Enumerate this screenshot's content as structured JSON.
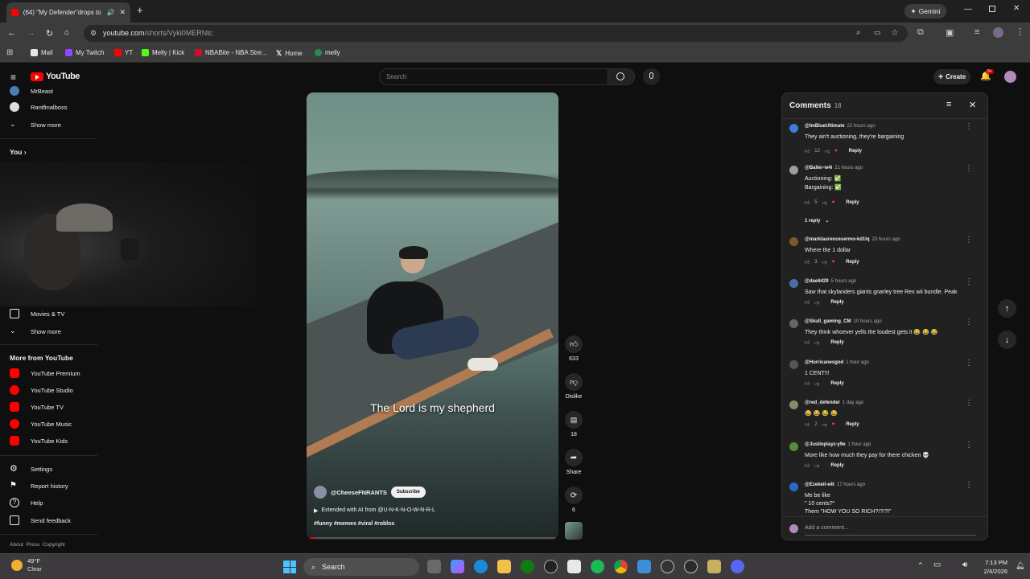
{
  "browser": {
    "tab_title": "(64) \"My Defender\"drops to",
    "url_domain": "youtube.com",
    "url_path": "/shorts/Vyki0MERNtc",
    "gemini_label": "Gemini",
    "bookmarks": [
      "Mail",
      "My Twitch",
      "YT",
      "Melly | Kick",
      "NBABite - NBA Stre...",
      "Home",
      "melly"
    ]
  },
  "youtube": {
    "logo": "YouTube",
    "search_placeholder": "Search",
    "create_label": "Create",
    "notif_badge": "9+"
  },
  "sidebar": {
    "subs": [
      "MrBeast",
      "Rantfinalboss"
    ],
    "show_more": "Show more",
    "you_label": "You",
    "movies": "Movies & TV",
    "show_more_2": "Show more",
    "more_heading": "More from YouTube",
    "more_items": [
      "YouTube Premium",
      "YouTube Studio",
      "YouTube TV",
      "YouTube Music",
      "YouTube Kids"
    ],
    "settings_items": [
      "Settings",
      "Report history",
      "Help",
      "Send feedback"
    ],
    "footer": "About  Press  Copyright"
  },
  "video": {
    "caption": "The Lord is my shepherd",
    "channel": "@CheeseFNRANTS",
    "subscribe": "Subscribe",
    "extended": "Extended with AI from @U-N-K-N-O-W-N-R-L",
    "tags": "#funny #memes #viral #roblox",
    "likes": "633",
    "dislike_label": "Dislike",
    "comments_count": "18",
    "share_label": "Share",
    "remix_count": "6"
  },
  "comments": {
    "title": "Comments",
    "count": "18",
    "add_placeholder": "Add a comment...",
    "reply_label": "Reply",
    "items": [
      {
        "author": "@ImBlueUltimate",
        "time": "22 hours ago",
        "lines": [
          "They ain't auctioning, they're bargaining"
        ],
        "likes": "12",
        "color": "#3b7dd8"
      },
      {
        "author": "@Baller-w4i",
        "time": "21 hours ago",
        "lines": [
          "Auctioning: ✅",
          "Bargaining: ✅"
        ],
        "likes": "5",
        "color": "#9e9e9e",
        "replies": "1 reply"
      },
      {
        "author": "@marklaurencesermo-kd1lq",
        "time": "23 hours ago",
        "lines": [
          "Where the 1 dollar"
        ],
        "likes": "3",
        "color": "#7a5a2a"
      },
      {
        "author": "@dae6429",
        "time": "5 hours ago",
        "lines": [
          "Saw that skylanders giants gnarley tree Rex wii bundle. Peak"
        ],
        "likes": "",
        "color": "#4a6ea8"
      },
      {
        "author": "@Skull_gaming_CM",
        "time": "10 hours ago",
        "lines": [
          "They think whoever yells the loudest gets it 😂 😂 😂"
        ],
        "likes": "",
        "color": "#666666"
      },
      {
        "author": "@Hurricanesgod",
        "time": "1 hour ago",
        "lines": [
          "1 CENT!!!"
        ],
        "likes": "",
        "color": "#555555"
      },
      {
        "author": "@red_defender",
        "time": "1 day ago",
        "lines": [
          "😂 😂 😂 😂"
        ],
        "likes": "2",
        "color": "#8a8a6a"
      },
      {
        "author": "@Justinplayz-y9e",
        "time": "1 hour ago",
        "lines": [
          "More like how much they pay for there chicken 💀"
        ],
        "likes": "",
        "color": "#5a8a3a"
      },
      {
        "author": "@Ezekeil-e4t",
        "time": "17 hours ago",
        "lines": [
          "Me be like",
          "\" 10 cents?\"",
          "Them \"HOW YOU SO RICH?!?!?!\""
        ],
        "likes": "",
        "color": "#2a6ad0"
      }
    ]
  },
  "taskbar": {
    "weather_temp": "49°F",
    "weather_desc": "Clear",
    "search_label": "Search",
    "time": "7:13 PM",
    "date": "2/4/2026"
  },
  "colors": {
    "youtube_red": "#ff0000",
    "bg": "#0f0f0f",
    "panel": "#212121",
    "taskbar": "#3c3a3c"
  }
}
